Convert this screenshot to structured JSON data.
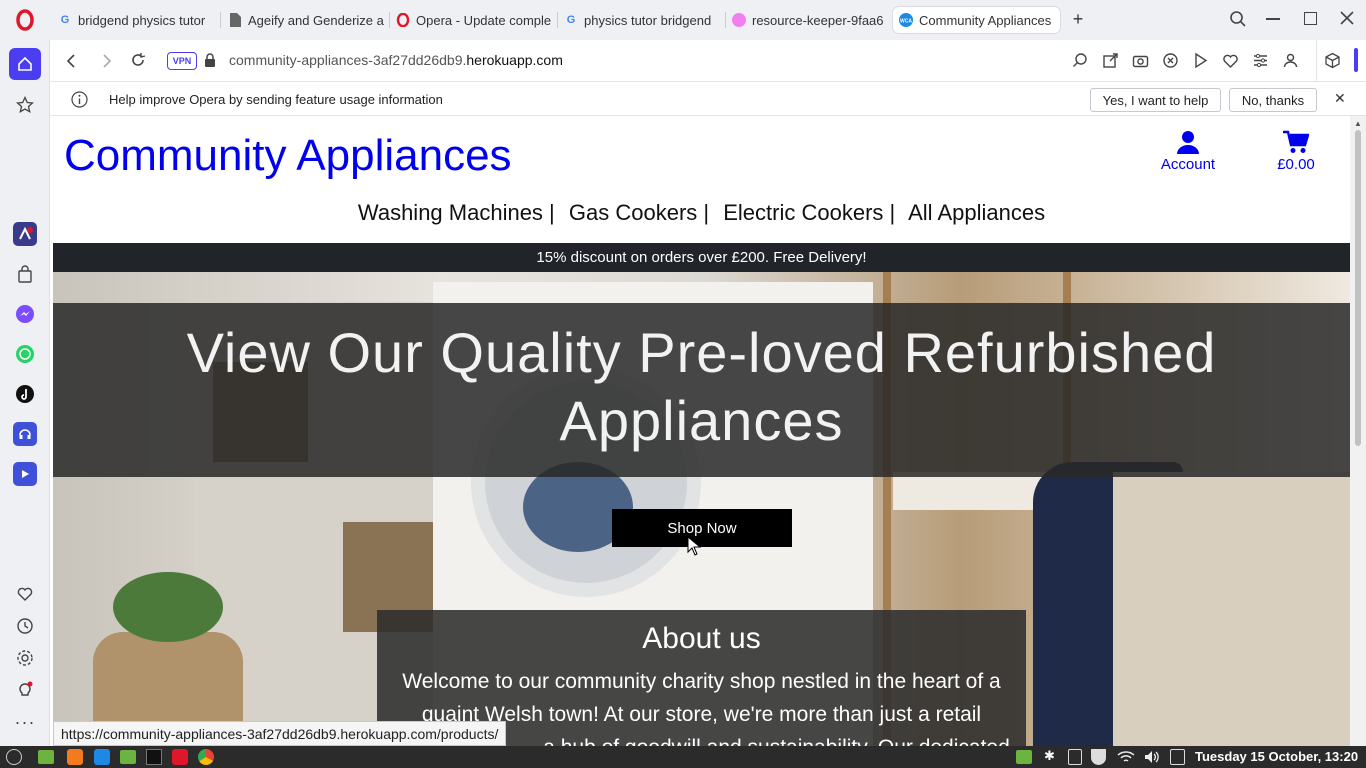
{
  "browser": {
    "tabs": [
      {
        "title": "bridgend physics tutor",
        "icon": "google-icon"
      },
      {
        "title": "Ageify and Genderize a",
        "icon": "document-icon"
      },
      {
        "title": "Opera - Update comple",
        "icon": "opera-icon"
      },
      {
        "title": "physics tutor bridgend",
        "icon": "google-icon"
      },
      {
        "title": "resource-keeper-9faa6",
        "icon": "pink-circle-icon"
      },
      {
        "title": "Community Appliances",
        "icon": "wca-icon",
        "active": true
      }
    ],
    "vpn_label": "VPN",
    "url_prefix": "community-appliances-3af27dd26db9.",
    "url_domain": "herokuapp.com",
    "infobar": {
      "message": "Help improve Opera by sending feature usage information",
      "accept_label": "Yes, I want to help",
      "decline_label": "No, thanks"
    },
    "status_url": "https://community-appliances-3af27dd26db9.herokuapp.com/products/"
  },
  "site": {
    "logo": "Community Appliances",
    "account_label": "Account",
    "cart_total": "£0.00",
    "nav": [
      "Washing Machines |",
      "Gas Cookers |",
      "Electric Cookers |",
      "All Appliances"
    ],
    "banner": "15% discount on orders over £200. Free Delivery!",
    "hero_title_line1": "View Our Quality Pre-loved Refurbished",
    "hero_title_line2": "Appliances",
    "shop_button": "Shop Now",
    "about_title": "About us",
    "about_lines": [
      "Welcome to our community charity shop nestled in the heart of a",
      "quaint Welsh town! At our store, we're more than just a retail",
      "a hub of goodwill and sustainability. Our dedicated"
    ]
  },
  "taskbar": {
    "datetime": "Tuesday 15 October, 13:20"
  },
  "colors": {
    "brand_blue": "#0000ee",
    "banner_bg": "#212529",
    "opera_red": "#e0162b",
    "sidebar_active": "#4b3df2"
  }
}
